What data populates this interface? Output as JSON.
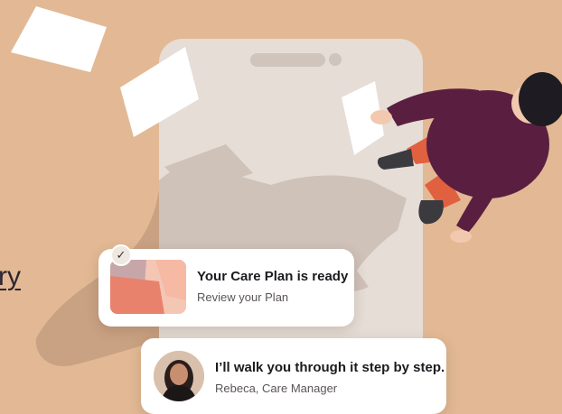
{
  "background_color": "#e2b994",
  "link_fragment": "ry",
  "plan_card": {
    "title": "Your Care Plan is ready",
    "subtitle": "Review your Plan",
    "check_icon": "check-icon"
  },
  "manager_card": {
    "message": "I’ll walk you through it step by step.",
    "signature": "Rebeca, Care Manager",
    "avatar_icon": "person-avatar"
  },
  "colors": {
    "phone": "#e5ddd6",
    "shadow": "#c49c80",
    "sweater": "#5a1f40",
    "pants": "#e0603f",
    "skin": "#f2c9ae",
    "hair": "#1e1c22"
  }
}
